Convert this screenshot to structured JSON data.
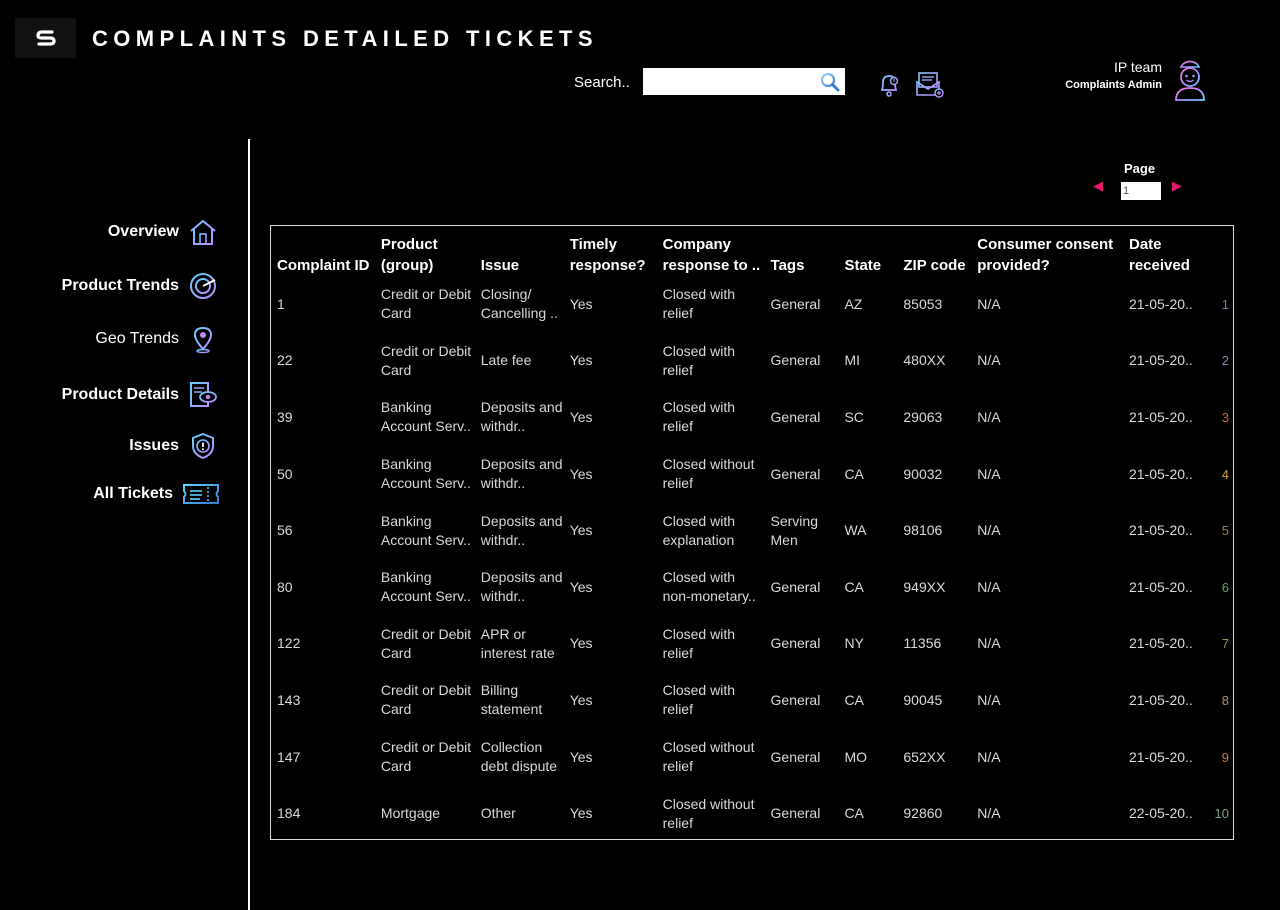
{
  "header": {
    "title": "COMPLAINTS DETAILED TICKETS",
    "search_label": "Search..",
    "search_value": "",
    "user_name": "IP team",
    "user_role": "Complaints Admin"
  },
  "icons": {
    "logo": "brand-logo-icon",
    "search": "search-icon",
    "notification": "bell-icon",
    "mail": "mail-icon",
    "avatar": "avatar-icon"
  },
  "sidebar": {
    "items": [
      {
        "label": "Overview",
        "icon": "house-icon"
      },
      {
        "label": "Product Trends",
        "icon": "trend-icon"
      },
      {
        "label": "Geo Trends",
        "icon": "location-pin-icon"
      },
      {
        "label": "Product Details",
        "icon": "document-eye-icon"
      },
      {
        "label": "Issues",
        "icon": "shield-alert-icon"
      },
      {
        "label": "All Tickets",
        "icon": "ticket-icon"
      }
    ]
  },
  "pager": {
    "label": "Page",
    "value": "1",
    "prev_glyph": "◀",
    "next_glyph": "▶"
  },
  "table": {
    "columns": [
      "Complaint ID",
      "Product (group)",
      "Issue",
      "Timely response?",
      "Company response to ..",
      "Tags",
      "State",
      "ZIP code",
      "Consumer consent provided?",
      "Date received",
      ""
    ],
    "rows": [
      {
        "id": "1",
        "product": "Credit or Debit Card",
        "issue": "Closing/ Cancelling ..",
        "timely": "Yes",
        "response": "Closed with relief",
        "tags": "General",
        "state": "AZ",
        "zip": "85053",
        "consent": "N/A",
        "date": "21-05-20..",
        "idx": "1"
      },
      {
        "id": "22",
        "product": "Credit or Debit Card",
        "issue": "Late fee",
        "timely": "Yes",
        "response": "Closed with relief",
        "tags": "General",
        "state": "MI",
        "zip": "480XX",
        "consent": "N/A",
        "date": "21-05-20..",
        "idx": "2"
      },
      {
        "id": "39",
        "product": "Banking Account Serv..",
        "issue": "Deposits and withdr..",
        "timely": "Yes",
        "response": "Closed with relief",
        "tags": "General",
        "state": "SC",
        "zip": "29063",
        "consent": "N/A",
        "date": "21-05-20..",
        "idx": "3"
      },
      {
        "id": "50",
        "product": "Banking Account Serv..",
        "issue": "Deposits and withdr..",
        "timely": "Yes",
        "response": "Closed without relief",
        "tags": "General",
        "state": "CA",
        "zip": "90032",
        "consent": "N/A",
        "date": "21-05-20..",
        "idx": "4"
      },
      {
        "id": "56",
        "product": "Banking Account Serv..",
        "issue": "Deposits and withdr..",
        "timely": "Yes",
        "response": "Closed with explanation",
        "tags": "Serving Men",
        "state": "WA",
        "zip": "98106",
        "consent": "N/A",
        "date": "21-05-20..",
        "idx": "5"
      },
      {
        "id": "80",
        "product": "Banking Account Serv..",
        "issue": "Deposits and withdr..",
        "timely": "Yes",
        "response": "Closed with non-monetary..",
        "tags": "General",
        "state": "CA",
        "zip": "949XX",
        "consent": "N/A",
        "date": "21-05-20..",
        "idx": "6"
      },
      {
        "id": "122",
        "product": "Credit or Debit Card",
        "issue": "APR or interest rate",
        "timely": "Yes",
        "response": "Closed with relief",
        "tags": "General",
        "state": "NY",
        "zip": "11356",
        "consent": "N/A",
        "date": "21-05-20..",
        "idx": "7"
      },
      {
        "id": "143",
        "product": "Credit or Debit Card",
        "issue": "Billing statement",
        "timely": "Yes",
        "response": "Closed with relief",
        "tags": "General",
        "state": "CA",
        "zip": "90045",
        "consent": "N/A",
        "date": "21-05-20..",
        "idx": "8"
      },
      {
        "id": "147",
        "product": "Credit or Debit Card",
        "issue": "Collection debt dispute",
        "timely": "Yes",
        "response": "Closed without relief",
        "tags": "General",
        "state": "MO",
        "zip": "652XX",
        "consent": "N/A",
        "date": "21-05-20..",
        "idx": "9"
      },
      {
        "id": "184",
        "product": "Mortgage",
        "issue": "Other",
        "timely": "Yes",
        "response": "Closed without relief",
        "tags": "General",
        "state": "CA",
        "zip": "92860",
        "consent": "N/A",
        "date": "22-05-20..",
        "idx": "10"
      }
    ],
    "index_colors": [
      "#6f7fb8",
      "#7f8fbf",
      "#c56a3c",
      "#d39a3a",
      "#a08060",
      "#5fa06a",
      "#8a9a5a",
      "#b09070",
      "#d07a3a",
      "#7f9f8a"
    ]
  }
}
